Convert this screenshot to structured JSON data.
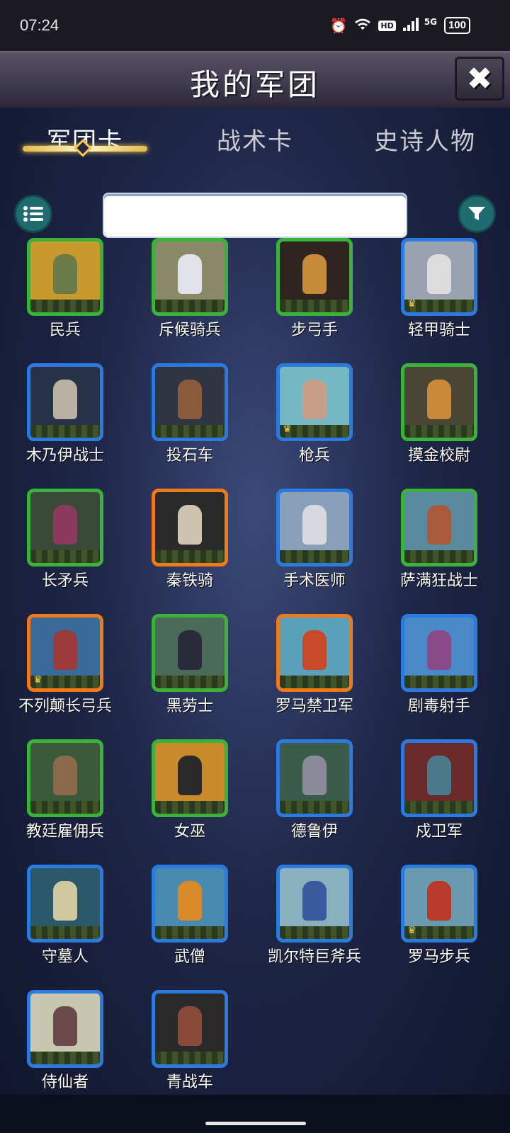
{
  "status_bar": {
    "time": "07:24",
    "icons": [
      "alarm-icon",
      "wifi-icon",
      "hd-icon",
      "signal-icon"
    ],
    "hd": "HD",
    "network": "5G",
    "battery": "100"
  },
  "header": {
    "title": "我的军团",
    "close_label": "✖"
  },
  "tabs": [
    {
      "label": "军团卡",
      "active": true
    },
    {
      "label": "战术卡",
      "active": false
    },
    {
      "label": "史诗人物",
      "active": false
    }
  ],
  "search": {
    "value": "",
    "placeholder": ""
  },
  "colors": {
    "green_frame": "#3bb33b",
    "blue_frame": "#2b7ae0",
    "orange_frame": "#f07a1a"
  },
  "cards": [
    {
      "name": "民兵",
      "rarity": "green",
      "crown": false,
      "bg": "#c89a2e",
      "fig": "#6b7c4a"
    },
    {
      "name": "斥候骑兵",
      "rarity": "green",
      "crown": false,
      "bg": "#8a8a6a",
      "fig": "#e2e2ea"
    },
    {
      "name": "步弓手",
      "rarity": "green",
      "crown": false,
      "bg": "#2e2420",
      "fig": "#c58a3a"
    },
    {
      "name": "轻甲骑士",
      "rarity": "blue",
      "crown": true,
      "bg": "#9aa2b2",
      "fig": "#dcdcdc"
    },
    {
      "name": "木乃伊战士",
      "rarity": "blue",
      "crown": false,
      "bg": "#26324a",
      "fig": "#b8b0a0"
    },
    {
      "name": "投石车",
      "rarity": "blue",
      "crown": false,
      "bg": "#2e3440",
      "fig": "#8a5a3a"
    },
    {
      "name": "枪兵",
      "rarity": "blue",
      "crown": true,
      "bg": "#76b8c2",
      "fig": "#c8a08a"
    },
    {
      "name": "摸金校尉",
      "rarity": "green",
      "crown": false,
      "bg": "#4a4636",
      "fig": "#c88a3a"
    },
    {
      "name": "长矛兵",
      "rarity": "green",
      "crown": false,
      "bg": "#3a4a3a",
      "fig": "#8a3a5a"
    },
    {
      "name": "秦铁骑",
      "rarity": "orange",
      "crown": false,
      "bg": "#2a2a2a",
      "fig": "#d0c4b0"
    },
    {
      "name": "手术医师",
      "rarity": "blue",
      "crown": false,
      "bg": "#8aa0b8",
      "fig": "#d8d8e0"
    },
    {
      "name": "萨满狂战士",
      "rarity": "green",
      "crown": false,
      "bg": "#5a8aa0",
      "fig": "#a85a3a"
    },
    {
      "name": "不列颠长弓兵",
      "rarity": "orange",
      "crown": true,
      "bg": "#3a6a9a",
      "fig": "#9a3a3a"
    },
    {
      "name": "黑劳士",
      "rarity": "green",
      "crown": false,
      "bg": "#4a6a5a",
      "fig": "#2a2a3a"
    },
    {
      "name": "罗马禁卫军",
      "rarity": "orange",
      "crown": false,
      "bg": "#5aa0b8",
      "fig": "#c84a2a"
    },
    {
      "name": "剧毒射手",
      "rarity": "blue",
      "crown": false,
      "bg": "#4a8ac8",
      "fig": "#8a4a8a"
    },
    {
      "name": "教廷雇佣兵",
      "rarity": "green",
      "crown": false,
      "bg": "#3a5a3a",
      "fig": "#8a6a4a"
    },
    {
      "name": "女巫",
      "rarity": "green",
      "crown": false,
      "bg": "#c88a2a",
      "fig": "#2a2a2a"
    },
    {
      "name": "德鲁伊",
      "rarity": "blue",
      "crown": false,
      "bg": "#3a5a4a",
      "fig": "#8a8a9a"
    },
    {
      "name": "戍卫军",
      "rarity": "blue",
      "crown": false,
      "bg": "#6a2a2a",
      "fig": "#4a7a8a"
    },
    {
      "name": "守墓人",
      "rarity": "blue",
      "crown": false,
      "bg": "#2a5a6a",
      "fig": "#d0c8a0"
    },
    {
      "name": "武僧",
      "rarity": "blue",
      "crown": false,
      "bg": "#4a8ab0",
      "fig": "#d88a2a"
    },
    {
      "name": "凯尔特巨斧兵",
      "rarity": "blue",
      "crown": false,
      "bg": "#8ab0c0",
      "fig": "#3a5aa0"
    },
    {
      "name": "罗马步兵",
      "rarity": "blue",
      "crown": true,
      "bg": "#6a9ab0",
      "fig": "#b83a2a"
    },
    {
      "name": "侍仙者",
      "rarity": "blue",
      "crown": false,
      "bg": "#c8c8b0",
      "fig": "#6a4a4a"
    },
    {
      "name": "青战车",
      "rarity": "blue",
      "crown": false,
      "bg": "#2a2a2a",
      "fig": "#8a4a3a"
    }
  ]
}
